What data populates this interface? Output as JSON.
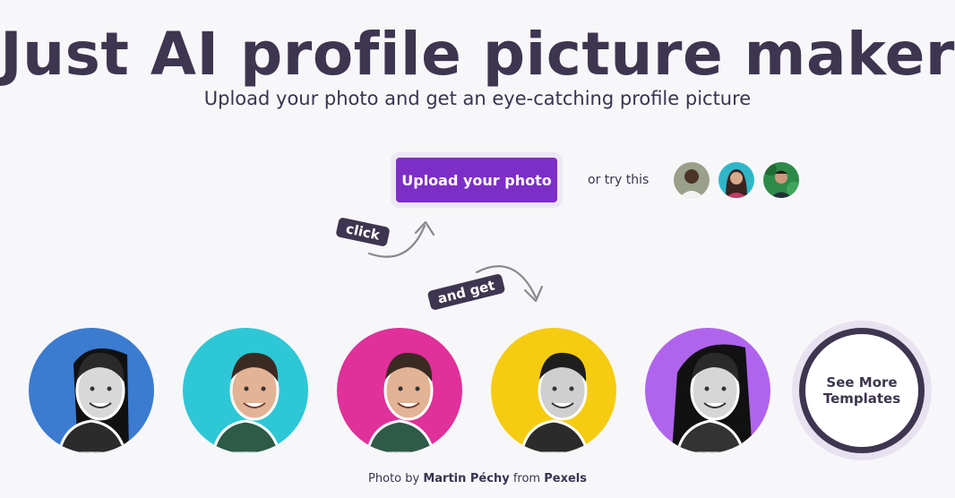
{
  "hero": {
    "title": "Just AI profile picture maker",
    "subtitle": "Upload your photo and get an eye-catching profile picture"
  },
  "actions": {
    "upload_label": "Upload your photo",
    "or_try": "or try this"
  },
  "annotations": {
    "click": "click",
    "and_get": "and get"
  },
  "samples": [
    {
      "name": "sample-photo-1",
      "bg": "#9aa08a"
    },
    {
      "name": "sample-photo-2",
      "bg": "#2fb7c9"
    },
    {
      "name": "sample-photo-3",
      "bg": "#2e8a4a"
    }
  ],
  "templates": [
    {
      "name": "template-blue",
      "bg": "#3b7bd0"
    },
    {
      "name": "template-cyan",
      "bg": "#2ec7d6"
    },
    {
      "name": "template-magenta",
      "bg": "#e0309a"
    },
    {
      "name": "template-yellow",
      "bg": "#f5cc10"
    },
    {
      "name": "template-purple",
      "bg": "#b064ee"
    }
  ],
  "see_more": {
    "line1": "See More",
    "line2": "Templates"
  },
  "credit": {
    "prefix": "Photo by ",
    "author": "Martin Péchy",
    "middle": " from ",
    "source": "Pexels"
  },
  "colors": {
    "accent": "#7d2ec7",
    "text": "#3e3550",
    "background": "#f7f7f9"
  }
}
